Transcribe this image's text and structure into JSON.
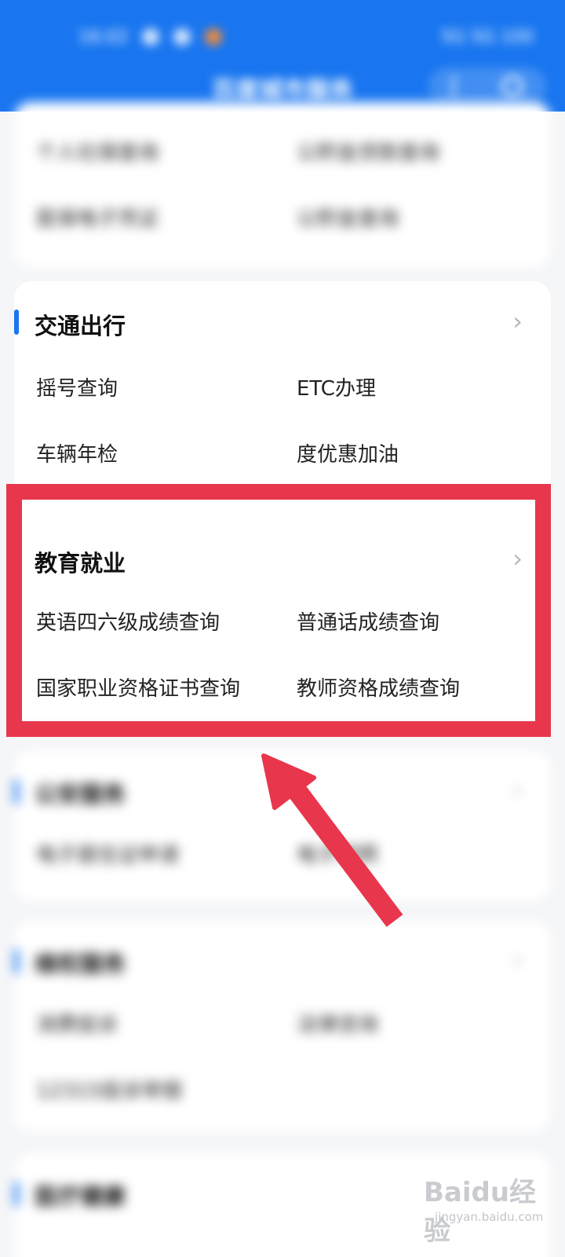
{
  "status_bar": {
    "time": "16:02",
    "signal": "5G 5G 100"
  },
  "header": {
    "title": "百度城市服务"
  },
  "sections": {
    "social": {
      "items": [
        "个人社保查询",
        "公积金贷款查询",
        "医保电子凭证",
        "公积金查询"
      ]
    },
    "transport": {
      "title": "交通出行",
      "items": [
        "摇号查询",
        "ETC办理",
        "车辆年检",
        "度优惠加油"
      ]
    },
    "education": {
      "title": "教育就业",
      "items": [
        "英语四六级成绩查询",
        "普通话成绩查询",
        "国家职业资格证书查询",
        "教师资格成绩查询"
      ]
    },
    "police": {
      "title": "公安服务",
      "items": [
        "电子居住证申请",
        "电子驾照"
      ]
    },
    "rights": {
      "title": "维权服务",
      "items": [
        "消费投诉",
        "法律咨询",
        "12315投诉举报"
      ]
    },
    "medical": {
      "title": "医疗健康"
    }
  },
  "icons": {
    "chevron": "chevron-right-icon"
  },
  "colors": {
    "accent": "#1976f0",
    "highlight": "#e8364c"
  },
  "watermark": {
    "logo": "Baidu经验",
    "site": "jingyan.baidu.com"
  }
}
